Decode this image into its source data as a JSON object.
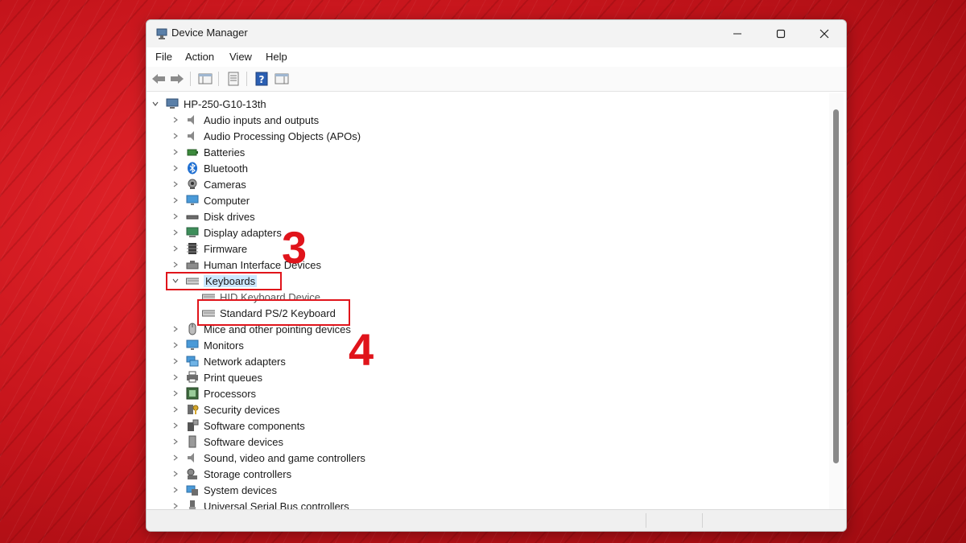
{
  "window": {
    "title": "Device Manager",
    "controls": {
      "minimize": "minimize-icon",
      "maximize": "maximize-icon",
      "close": "close-icon"
    }
  },
  "menu": [
    "File",
    "Action",
    "View",
    "Help"
  ],
  "toolbar": {
    "buttons": [
      "back-arrow-icon",
      "forward-arrow-icon",
      "show-hide-tree-icon",
      "properties-icon",
      "help-icon",
      "action-pane-icon"
    ]
  },
  "tree": {
    "root": "HP-250-G10-13th",
    "items": [
      "Audio inputs and outputs",
      "Audio Processing Objects (APOs)",
      "Batteries",
      "Bluetooth",
      "Cameras",
      "Computer",
      "Disk drives",
      "Display adapters",
      "Firmware",
      "Human Interface Devices",
      "Keyboards",
      "HID Keyboard Device",
      "Standard PS/2 Keyboard",
      "Mice and other pointing devices",
      "Monitors",
      "Network adapters",
      "Print queues",
      "Processors",
      "Security devices",
      "Software components",
      "Software devices",
      "Sound, video and game controllers",
      "Storage controllers",
      "System devices",
      "Universal Serial Bus controllers"
    ],
    "expanded": "Keyboards"
  },
  "annotations": {
    "step3": "3",
    "step4": "4",
    "color": "#e0141b"
  },
  "colors": {
    "accent": "#0063b1",
    "highlight": "#cce8ff",
    "annotation": "#e0141b"
  }
}
